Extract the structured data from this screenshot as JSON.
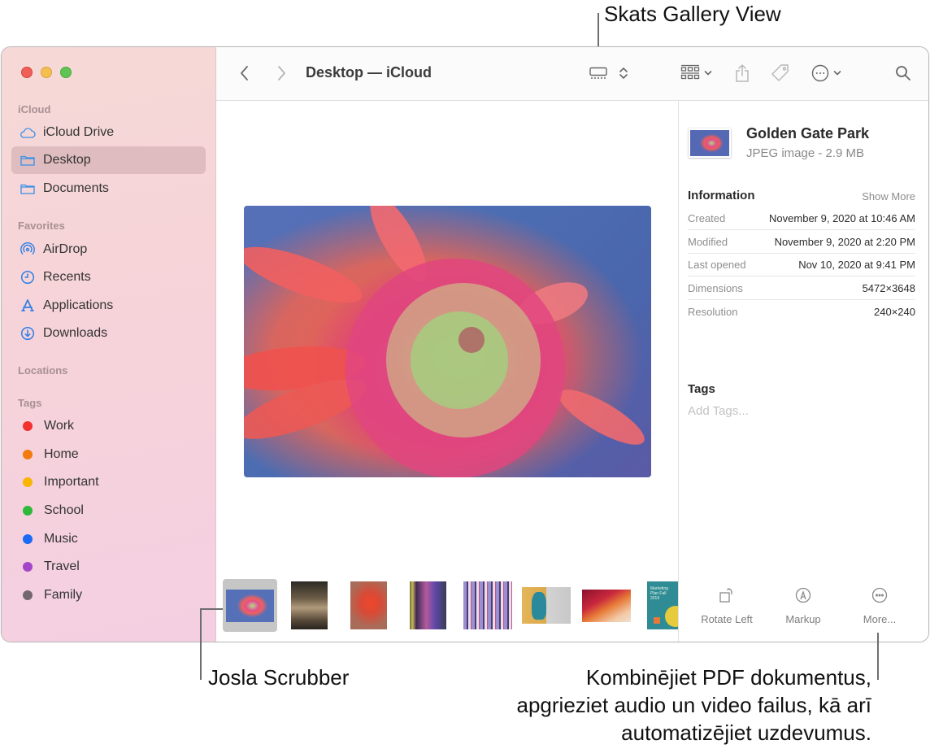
{
  "callouts": {
    "gallery_view": "Skats Gallery View",
    "scrubber_bar": "Josla Scrubber",
    "more_actions": [
      "Kombinējiet PDF dokumentus,",
      "apgrieziet audio un video failus, kā arī",
      "automatizējiet uzdevumus."
    ]
  },
  "window": {
    "title": "Desktop — iCloud"
  },
  "sidebar": {
    "sections": [
      {
        "heading": "iCloud",
        "items": [
          {
            "label": "iCloud Drive",
            "icon": "cloud-icon"
          },
          {
            "label": "Desktop",
            "icon": "folder-icon",
            "selected": true
          },
          {
            "label": "Documents",
            "icon": "folder-icon"
          }
        ]
      },
      {
        "heading": "Favorites",
        "items": [
          {
            "label": "AirDrop",
            "icon": "airdrop-icon"
          },
          {
            "label": "Recents",
            "icon": "clock-icon"
          },
          {
            "label": "Applications",
            "icon": "applications-icon"
          },
          {
            "label": "Downloads",
            "icon": "download-icon"
          }
        ]
      },
      {
        "heading": "Locations",
        "items": []
      },
      {
        "heading": "Tags",
        "items": [
          {
            "label": "Work",
            "color": "#f3302e"
          },
          {
            "label": "Home",
            "color": "#f27a0f"
          },
          {
            "label": "Important",
            "color": "#f7b400"
          },
          {
            "label": "School",
            "color": "#2fb83a"
          },
          {
            "label": "Music",
            "color": "#1b6bf5"
          },
          {
            "label": "Travel",
            "color": "#a346c8"
          },
          {
            "label": "Family",
            "color": "#73676f"
          }
        ]
      }
    ]
  },
  "toolbar": {
    "back": "back-icon",
    "forward": "forward-icon",
    "view_mode": "gallery-view-icon",
    "group": "group-icon",
    "share": "share-icon",
    "tag": "tag-icon",
    "action": "action-icon",
    "search": "search-icon"
  },
  "inspector": {
    "file_name": "Golden Gate Park",
    "file_kind": "JPEG image - 2.9 MB",
    "information_heading": "Information",
    "show_more": "Show More",
    "info": [
      {
        "label": "Created",
        "value": "November 9, 2020 at 10:46 AM"
      },
      {
        "label": "Modified",
        "value": "November 9, 2020 at 2:20 PM"
      },
      {
        "label": "Last opened",
        "value": "Nov 10, 2020 at 9:41 PM"
      },
      {
        "label": "Dimensions",
        "value": "5472×3648"
      },
      {
        "label": "Resolution",
        "value": "240×240"
      }
    ],
    "tags_heading": "Tags",
    "add_tags_placeholder": "Add Tags...",
    "quick_actions": [
      {
        "label": "Rotate Left",
        "icon": "rotate-left-icon"
      },
      {
        "label": "Markup",
        "icon": "markup-icon"
      },
      {
        "label": "More...",
        "icon": "more-icon"
      }
    ]
  },
  "scrubber": {
    "thumbnails": [
      {
        "name": "flower-photo",
        "selected": true
      },
      {
        "name": "forest-road-photo"
      },
      {
        "name": "red-powder-hands-photo"
      },
      {
        "name": "neon-portrait-photo"
      },
      {
        "name": "striped-wall-photo"
      },
      {
        "name": "louisa-parris-document"
      },
      {
        "name": "abstract-gradient-image"
      },
      {
        "name": "marketing-plan-document",
        "text": "Marketing Plan Fall 2019"
      }
    ]
  }
}
